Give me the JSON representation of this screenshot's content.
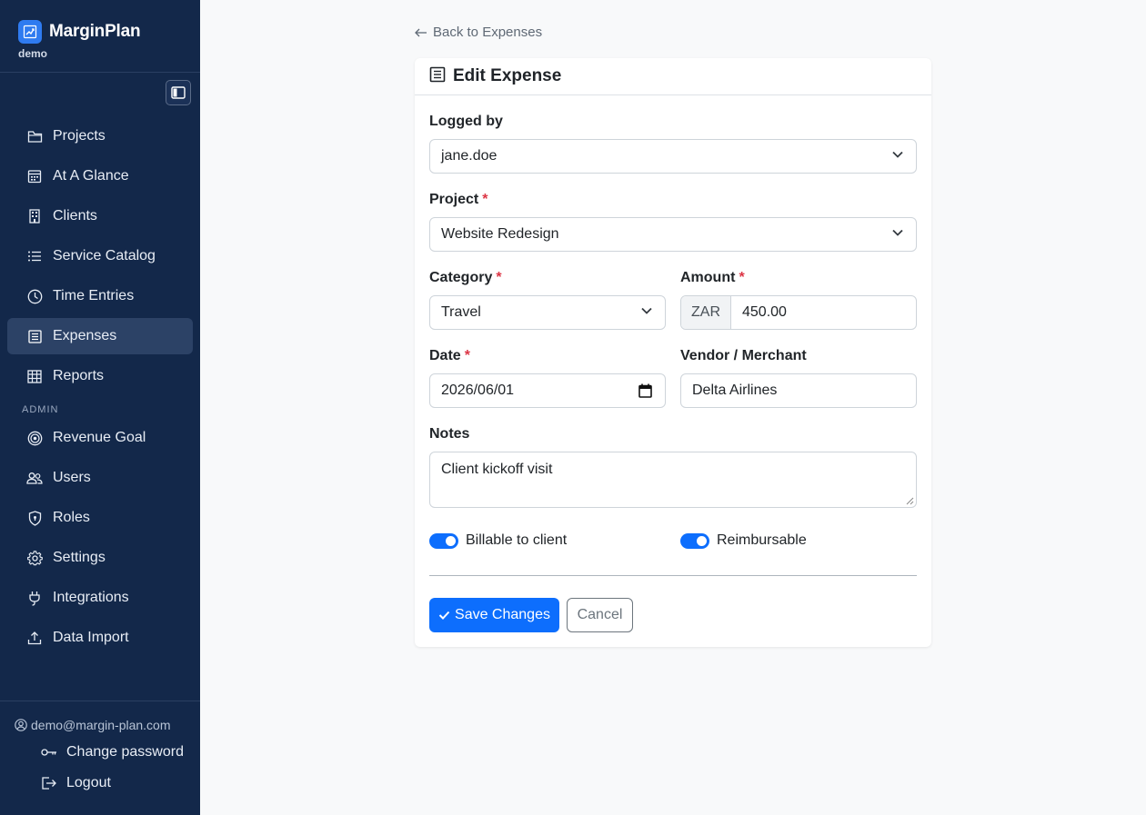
{
  "app": {
    "name": "MarginPlan",
    "workspace": "demo"
  },
  "sidebar": {
    "items": [
      {
        "label": "Projects",
        "icon": "folder-icon"
      },
      {
        "label": "At A Glance",
        "icon": "calendar-icon"
      },
      {
        "label": "Clients",
        "icon": "building-icon"
      },
      {
        "label": "Service Catalog",
        "icon": "list-icon"
      },
      {
        "label": "Time Entries",
        "icon": "clock-icon"
      },
      {
        "label": "Expenses",
        "icon": "receipt-icon",
        "active": true
      },
      {
        "label": "Reports",
        "icon": "table-icon"
      }
    ],
    "admin_label": "ADMIN",
    "admin_items": [
      {
        "label": "Revenue Goal",
        "icon": "target-icon"
      },
      {
        "label": "Users",
        "icon": "people-icon"
      },
      {
        "label": "Roles",
        "icon": "shield-icon"
      },
      {
        "label": "Settings",
        "icon": "gear-icon"
      },
      {
        "label": "Integrations",
        "icon": "plug-icon"
      },
      {
        "label": "Data Import",
        "icon": "upload-icon"
      }
    ],
    "user_email": "demo@margin-plan.com",
    "change_password": "Change password",
    "logout": "Logout"
  },
  "main": {
    "back_link": "Back to Expenses",
    "card_title": "Edit Expense",
    "form": {
      "logged_by_label": "Logged by",
      "logged_by_value": "jane.doe",
      "project_label": "Project",
      "project_value": "Website Redesign",
      "category_label": "Category",
      "category_value": "Travel",
      "amount_label": "Amount",
      "currency": "ZAR",
      "amount_value": "450.00",
      "date_label": "Date",
      "date_value": "2026/06/01",
      "vendor_label": "Vendor / Merchant",
      "vendor_value": "Delta Airlines",
      "notes_label": "Notes",
      "notes_value": "Client kickoff visit",
      "billable_label": "Billable to client",
      "billable_on": true,
      "reimbursable_label": "Reimbursable",
      "reimbursable_on": true,
      "required_marker": "*"
    },
    "save_button": "Save Changes",
    "cancel_button": "Cancel"
  },
  "colors": {
    "sidebar_bg": "#13284a",
    "active_item_bg": "#2c4266",
    "primary": "#0d6efd",
    "required": "#dc3545"
  }
}
